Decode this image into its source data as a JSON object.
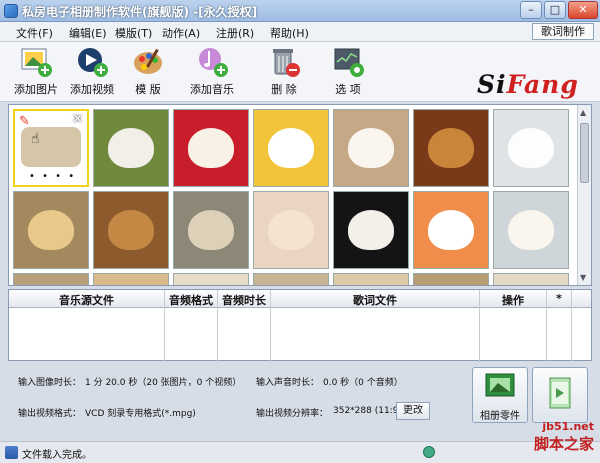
{
  "window": {
    "title": "私房电子相册制作软件(旗舰版) -[永久授权]",
    "minimize": "–",
    "maximize": "□",
    "close": "✕"
  },
  "menu": {
    "items": [
      "文件(F)",
      "编辑(E)",
      "模版(T)",
      "动作(A)",
      "注册(R)",
      "帮助(H)"
    ],
    "lyric_button": "歌词制作"
  },
  "toolbar": {
    "add_photo": "添加图片",
    "add_video": "添加视频",
    "template": "模 版",
    "add_music": "添加音乐",
    "delete": "删 除",
    "options": "选 项"
  },
  "logo": {
    "part1": "Si",
    "part2": "Fang"
  },
  "photos": {
    "selected_dots": "• • • •"
  },
  "music_table": {
    "columns": [
      "音乐源文件",
      "音频格式",
      "音频时长",
      "歌词文件",
      "操作",
      "*"
    ]
  },
  "info": {
    "image_duration_label": "输入图像时长：",
    "image_duration_value": "1 分 20.0 秒（20 张图片，0 个视频）",
    "audio_duration_label": "输入声音时长：",
    "audio_duration_value": "0.0 秒（0 个音频）",
    "video_format_label": "输出视频格式：",
    "video_format_value": "VCD 刻录专用格式(*.mpg)",
    "resolution_label": "输出视频分辨率：",
    "resolution_value": "352*288 (11:9)",
    "change_button": "更改",
    "album_button": "相册零件"
  },
  "status": {
    "text": "文件载入完成。"
  },
  "watermark": {
    "line1": "jb51.net",
    "line2": "脚本之家"
  }
}
